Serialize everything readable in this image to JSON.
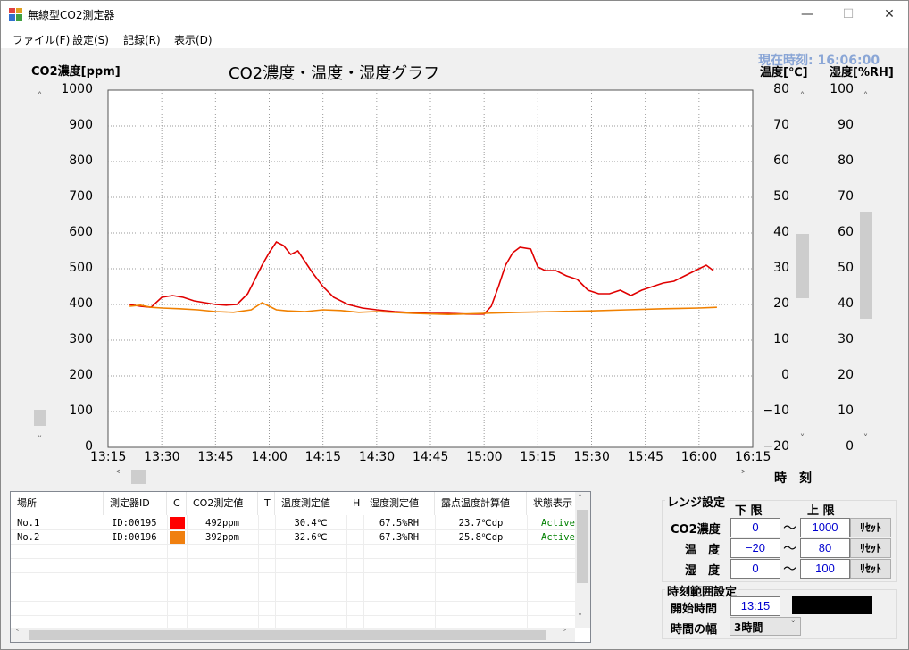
{
  "window": {
    "title": "無線型CO2測定器",
    "minimize": "—",
    "maximize": "☐",
    "close": "✕"
  },
  "menu": [
    "ファイル(F)",
    "設定(S)",
    "記録(R)",
    "表示(D)"
  ],
  "clock": "現在時刻: 16:06:00",
  "chart_data": {
    "type": "line",
    "title": "CO2濃度・温度・湿度グラフ",
    "ylabel_left": "CO2濃度[ppm]",
    "ylabel_right1": "温度[℃]",
    "ylabel_right2": "湿度[%RH]",
    "xlabel": "時　刻",
    "x_ticks": [
      "13:15",
      "13:30",
      "13:45",
      "14:00",
      "14:15",
      "14:30",
      "14:45",
      "15:00",
      "15:15",
      "15:30",
      "15:45",
      "16:00",
      "16:15"
    ],
    "y_ticks_left": [
      "1000",
      "900",
      "800",
      "700",
      "600",
      "500",
      "400",
      "300",
      "200",
      "100",
      "0"
    ],
    "y_ticks_temp": [
      "80",
      "70",
      "60",
      "50",
      "40",
      "30",
      "20",
      "10",
      "0",
      "−10",
      "−20"
    ],
    "y_ticks_hum": [
      "100",
      "90",
      "80",
      "70",
      "60",
      "50",
      "40",
      "30",
      "20",
      "10",
      "0"
    ],
    "ylim": [
      0,
      1000
    ],
    "xlim": [
      "13:15",
      "16:15"
    ],
    "grid": true,
    "series": [
      {
        "name": "No.1",
        "color": "#e00000",
        "x": [
          "13:21",
          "13:24",
          "13:27",
          "13:30",
          "13:33",
          "13:36",
          "13:39",
          "13:42",
          "13:45",
          "13:48",
          "13:51",
          "13:54",
          "13:56",
          "13:58",
          "14:00",
          "14:02",
          "14:04",
          "14:06",
          "14:08",
          "14:10",
          "14:12",
          "14:15",
          "14:18",
          "14:22",
          "14:26",
          "14:30",
          "14:35",
          "14:40",
          "14:45",
          "14:50",
          "14:55",
          "15:00",
          "15:02",
          "15:04",
          "15:06",
          "15:08",
          "15:10",
          "15:13",
          "15:15",
          "15:17",
          "15:20",
          "15:23",
          "15:26",
          "15:29",
          "15:32",
          "15:35",
          "15:38",
          "15:41",
          "15:44",
          "15:47",
          "15:50",
          "15:53",
          "15:56",
          "15:59",
          "16:02",
          "16:04"
        ],
        "values": [
          400,
          395,
          392,
          420,
          425,
          420,
          410,
          405,
          400,
          398,
          400,
          430,
          470,
          510,
          545,
          575,
          565,
          540,
          550,
          520,
          490,
          450,
          420,
          400,
          390,
          385,
          380,
          377,
          375,
          375,
          373,
          373,
          395,
          450,
          510,
          545,
          560,
          555,
          505,
          495,
          495,
          480,
          470,
          440,
          430,
          430,
          440,
          425,
          440,
          450,
          460,
          465,
          480,
          495,
          510,
          495
        ]
      },
      {
        "name": "No.2",
        "color": "#f08000",
        "x": [
          "13:21",
          "13:24",
          "13:27",
          "13:30",
          "13:35",
          "13:40",
          "13:45",
          "13:50",
          "13:55",
          "13:58",
          "14:00",
          "14:02",
          "14:05",
          "14:10",
          "14:15",
          "14:20",
          "14:25",
          "14:30",
          "14:40",
          "14:50",
          "15:00",
          "15:10",
          "15:20",
          "15:30",
          "15:40",
          "15:50",
          "16:00",
          "16:05"
        ],
        "values": [
          395,
          398,
          392,
          390,
          388,
          385,
          380,
          378,
          385,
          405,
          395,
          385,
          382,
          380,
          385,
          383,
          378,
          380,
          375,
          372,
          375,
          378,
          380,
          382,
          385,
          388,
          390,
          392
        ]
      }
    ]
  },
  "table": {
    "headers": [
      "場所",
      "測定器ID",
      "C",
      "CO2測定値",
      "T",
      "温度測定値",
      "H",
      "湿度測定値",
      "露点温度計算値",
      "状態表示"
    ],
    "rows": [
      {
        "place": "No.1",
        "id": "ID:00195",
        "color": "#ff0000",
        "co2": "492ppm",
        "temp": "30.4℃",
        "hum": "67.5%RH",
        "dew": "23.7℃dp",
        "status": "Active"
      },
      {
        "place": "No.2",
        "id": "ID:00196",
        "color": "#f08010",
        "co2": "392ppm",
        "temp": "32.6℃",
        "hum": "67.3%RH",
        "dew": "25.8℃dp",
        "status": "Active"
      }
    ]
  },
  "range": {
    "title": "レンジ設定",
    "lower": "下 限",
    "upper": "上 限",
    "rows": [
      {
        "label": "CO2濃度",
        "low": "0",
        "high": "1000",
        "reset": "ﾘｾｯﾄ"
      },
      {
        "label": "温　度",
        "low": "−20",
        "high": "80",
        "reset": "ﾘｾｯﾄ"
      },
      {
        "label": "湿　度",
        "low": "0",
        "high": "100",
        "reset": "ﾘｾｯﾄ"
      }
    ],
    "tilde": "〜"
  },
  "time_range": {
    "title": "時刻範囲設定",
    "start_label": "開始時間",
    "start_value": "13:15",
    "width_label": "時間の幅",
    "width_value": "3時間"
  }
}
